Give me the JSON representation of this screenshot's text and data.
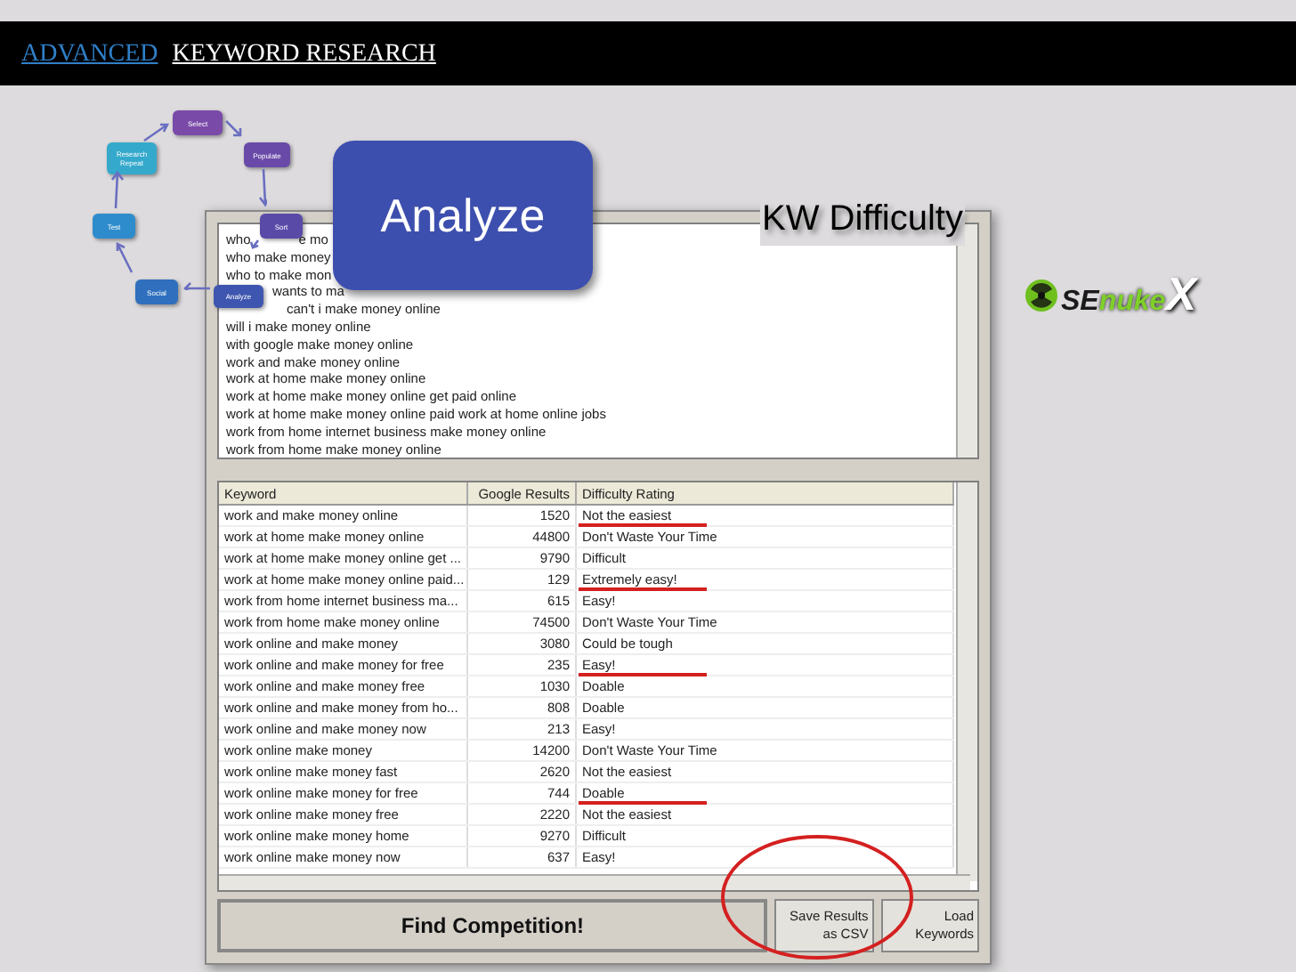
{
  "header": {
    "parts": [
      {
        "text": "ADVANCED",
        "kind": "accent"
      },
      {
        "text": "KEYWORD RESEARCH",
        "kind": "plain"
      }
    ]
  },
  "cycle": [
    {
      "label": "Select",
      "color": "#7a4aa8"
    },
    {
      "label": "Populate",
      "color": "#6a4aa8"
    },
    {
      "label": "Sort",
      "color": "#5a4aa8"
    },
    {
      "label": "Analyze",
      "color": "#3f56b0"
    },
    {
      "label": "Social",
      "color": "#2f6fbe"
    },
    {
      "label": "Test",
      "color": "#2f8ccc"
    },
    {
      "label": "Research Repeat",
      "color": "#35a9cc"
    }
  ],
  "callout": "Analyze",
  "kw_difficulty_label": "KW Difficulty",
  "logo": {
    "prefix": "SE",
    "word": "nuke",
    "suffix": "X"
  },
  "keyword_list": [
    {
      "parts": [
        "who",
        "e mo"
      ]
    },
    {
      "parts": [
        "who make money"
      ]
    },
    {
      "parts": [
        "who to make mon"
      ]
    },
    {
      "parts": [
        "wants to ma"
      ]
    },
    {
      "parts": [
        "can't i make money online"
      ]
    },
    {
      "parts": [
        "will i make money online"
      ]
    },
    {
      "parts": [
        "with google make money online"
      ]
    },
    {
      "parts": [
        "work and make money online"
      ]
    },
    {
      "parts": [
        "work at home make money online"
      ]
    },
    {
      "parts": [
        "work at home make money online get paid online"
      ]
    },
    {
      "parts": [
        "work at home make money online paid work at home online jobs"
      ]
    },
    {
      "parts": [
        "work from home internet business make money online"
      ]
    },
    {
      "parts": [
        "work from home make money online"
      ]
    }
  ],
  "table": {
    "columns": [
      "Keyword",
      "Google Results",
      "Difficulty Rating"
    ],
    "rows": [
      {
        "keyword": "work and make money online",
        "results": "1520",
        "rating": "Not the easiest",
        "underlined": true
      },
      {
        "keyword": "work at home make money online",
        "results": "44800",
        "rating": "Don't Waste Your Time",
        "underlined": false
      },
      {
        "keyword": "work at home make money online get ...",
        "results": "9790",
        "rating": "Difficult",
        "underlined": false
      },
      {
        "keyword": "work at home make money online paid...",
        "results": "129",
        "rating": "Extremely easy!",
        "underlined": true
      },
      {
        "keyword": "work from home internet business ma...",
        "results": "615",
        "rating": "Easy!",
        "underlined": false
      },
      {
        "keyword": "work from home make money online",
        "results": "74500",
        "rating": "Don't Waste Your Time",
        "underlined": false
      },
      {
        "keyword": "work online and make money",
        "results": "3080",
        "rating": "Could be tough",
        "underlined": false
      },
      {
        "keyword": "work online and make money for free",
        "results": "235",
        "rating": "Easy!",
        "underlined": true
      },
      {
        "keyword": "work online and make money free",
        "results": "1030",
        "rating": "Doable",
        "underlined": false
      },
      {
        "keyword": "work online and make money from ho...",
        "results": "808",
        "rating": "Doable",
        "underlined": false
      },
      {
        "keyword": "work online and make money now",
        "results": "213",
        "rating": "Easy!",
        "underlined": false
      },
      {
        "keyword": "work online make money",
        "results": "14200",
        "rating": "Don't Waste Your Time",
        "underlined": false
      },
      {
        "keyword": "work online make money fast",
        "results": "2620",
        "rating": "Not the easiest",
        "underlined": false
      },
      {
        "keyword": "work online make money for free",
        "results": "744",
        "rating": "Doable",
        "underlined": true
      },
      {
        "keyword": "work online make money free",
        "results": "2220",
        "rating": "Not the easiest",
        "underlined": false
      },
      {
        "keyword": "work online make money home",
        "results": "9270",
        "rating": "Difficult",
        "underlined": false
      },
      {
        "keyword": "work online make money now",
        "results": "637",
        "rating": "Easy!",
        "underlined": false
      }
    ]
  },
  "buttons": [
    {
      "label": "Find Competition!",
      "kind": "primary"
    },
    {
      "label": "Save Results as CSV",
      "kind": "small"
    },
    {
      "label": "Load Keywords",
      "kind": "small"
    }
  ]
}
